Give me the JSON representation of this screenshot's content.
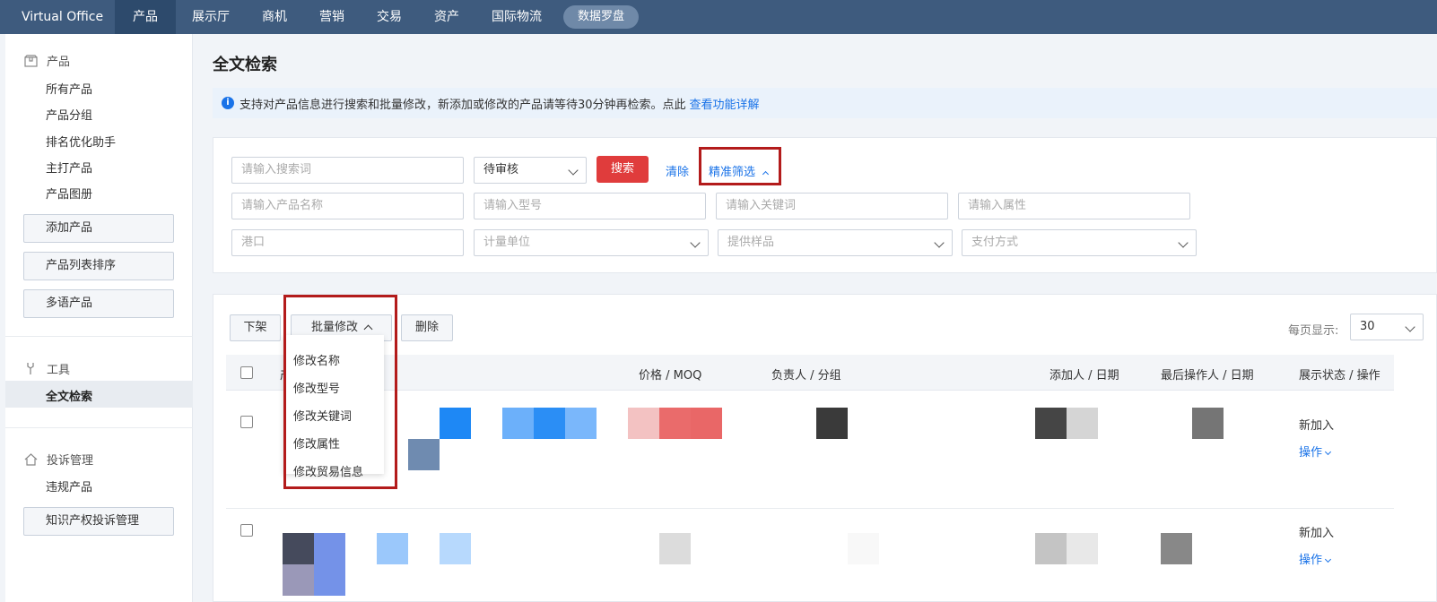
{
  "topnav": {
    "brand": "Virtual Office",
    "items": [
      "产品",
      "展示厅",
      "商机",
      "营销",
      "交易",
      "资产",
      "国际物流"
    ],
    "pill": "数据罗盘"
  },
  "sidebar": {
    "product_section": "产品",
    "product_links": [
      "所有产品",
      "产品分组",
      "排名优化助手",
      "主打产品",
      "产品图册"
    ],
    "product_buttons": [
      "添加产品",
      "产品列表排序",
      "多语产品"
    ],
    "tools_section": "工具",
    "tools_active": "全文检索",
    "complaint_section": "投诉管理",
    "complaint_link": "违规产品",
    "complaint_button": "知识产权投诉管理"
  },
  "main": {
    "title": "全文检索",
    "info_text": "支持对产品信息进行搜索和批量修改，新添加或修改的产品请等待30分钟再检索。点此",
    "info_link": "查看功能详解"
  },
  "search": {
    "keyword_placeholder": "请输入搜索词",
    "status_value": "待审核",
    "search_button": "搜索",
    "clear_link": "清除",
    "advanced_link": "精准筛选",
    "name_placeholder": "请输入产品名称",
    "model_placeholder": "请输入型号",
    "keyword2_placeholder": "请输入关键词",
    "attr_placeholder": "请输入属性",
    "port_placeholder": "港口",
    "unit_placeholder": "计量单位",
    "sample_placeholder": "提供样品",
    "payment_placeholder": "支付方式"
  },
  "toolbar": {
    "offline": "下架",
    "batch_edit": "批量修改",
    "delete": "删除",
    "per_page_label": "每页显示:",
    "per_page_value": "30"
  },
  "dropdown": [
    "修改名称",
    "修改型号",
    "修改关键词",
    "修改属性",
    "修改贸易信息"
  ],
  "table": {
    "headers": {
      "product": "产",
      "price": "价格 / MOQ",
      "owner": "负责人 / 分组",
      "added": "添加人 / 日期",
      "last_op": "最后操作人 / 日期",
      "status": "展示状态 / 操作"
    },
    "rows": [
      {
        "status": "新加入",
        "op": "操作"
      },
      {
        "status": "新加入",
        "op": "操作"
      }
    ]
  },
  "colors": {
    "nav_bg": "#3e5b7e",
    "accent_red": "#e03c3c",
    "link_blue": "#1a73e8",
    "annotation_red": "#b31b1b"
  }
}
